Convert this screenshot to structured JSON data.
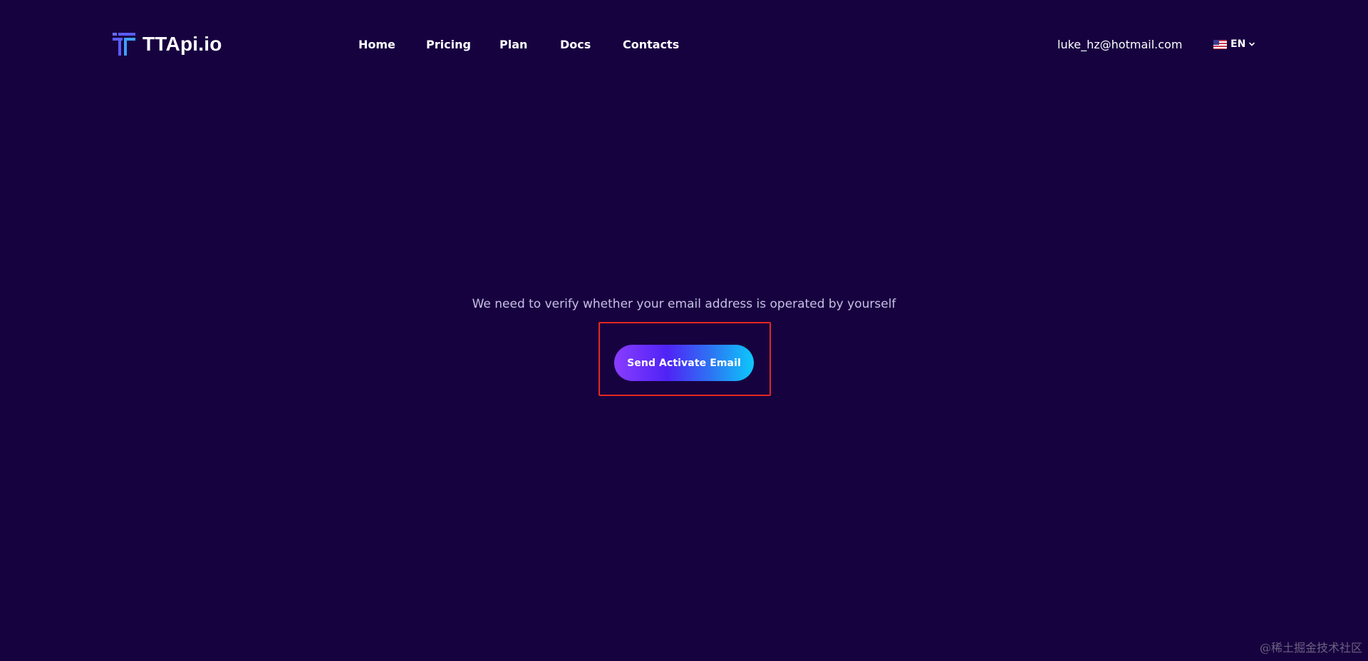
{
  "brand": {
    "name": "TTApi.io",
    "icon": "tt-logo-icon",
    "accent": "#5b5cf6"
  },
  "nav": {
    "items": [
      "Home",
      "Pricing",
      "Plan",
      "Docs",
      "Contacts"
    ]
  },
  "user": {
    "email": "luke_hz@hotmail.com"
  },
  "language": {
    "selected": "EN",
    "flag_icon": "us-flag-icon"
  },
  "main": {
    "message": "We need to verify whether your email address is operated by yourself",
    "button_label": "Send Activate Email"
  },
  "watermark": "@稀土掘金技术社区",
  "colors": {
    "background": "#170240",
    "highlight": "#e5271f",
    "button_gradient": [
      "#8a3dff",
      "#4f23f5",
      "#0cc8fb"
    ]
  }
}
